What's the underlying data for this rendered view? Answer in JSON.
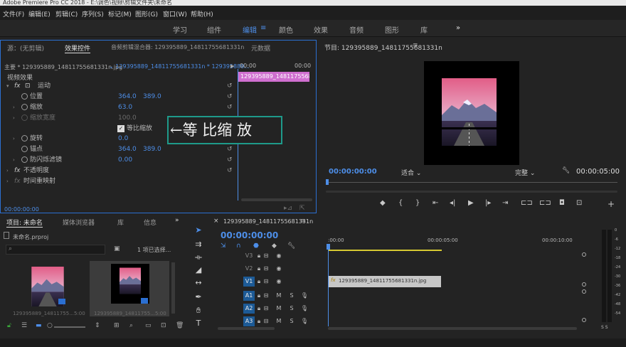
{
  "app": {
    "title": "Adobe Premiere Pro CC 2018 - E:\\调色\\视频\\剪辑文件夹\\未命名"
  },
  "menu": [
    "文件(F)",
    "编辑(E)",
    "剪辑(C)",
    "序列(S)",
    "标记(M)",
    "图形(G)",
    "窗口(W)",
    "帮助(H)"
  ],
  "workspaces": [
    "学习",
    "组件",
    "编辑",
    "颜色",
    "效果",
    "音频",
    "图形",
    "库"
  ],
  "workspace_active": "编辑",
  "workspace_more": "»",
  "effect_controls": {
    "tabs": [
      "源：(无剪辑)",
      "效果控件",
      "音频剪辑混合器: 129395889_14811755681331n",
      "元数据"
    ],
    "master_label": "主要 * 129395889_14811755681331n.jpg",
    "sequence_label": "129395889_14811755681331n * 129395889...",
    "time_start": "00:00",
    "time_end": "00:00",
    "clip_bar_label": "129395889_14811755681331n",
    "section_video": "视频效果",
    "motion": "运动",
    "params": [
      {
        "name": "位置",
        "v1": "364.0",
        "v2": "389.0"
      },
      {
        "name": "缩放",
        "v1": "63.0",
        "v2": ""
      },
      {
        "name": "缩放宽度",
        "v1": "100.0",
        "v2": ""
      },
      {
        "name": "旋转",
        "v1": "0.0",
        "v2": ""
      },
      {
        "name": "锚点",
        "v1": "364.0",
        "v2": "389.0"
      },
      {
        "name": "防闪烁滤镜",
        "v1": "0.00",
        "v2": ""
      }
    ],
    "uniform_scale": "等比缩放",
    "opacity": "不透明度",
    "time_remap": "时间重映射",
    "timecode": "00:00:00:00",
    "annotation": "←等 比缩 放"
  },
  "program": {
    "title": "节目: 129395889_14811755681331n",
    "timecode_left": "00:00:00:00",
    "fit": "适合",
    "quality": "完整",
    "timecode_right": "00:00:05:00"
  },
  "project": {
    "tabs": [
      "项目: 未命名",
      "媒体浏览器",
      "库",
      "信息"
    ],
    "file": "未命名.prproj",
    "selection": "1 项已选择...",
    "items": [
      {
        "name": "129395889_14811755...",
        "dur": "5:00"
      },
      {
        "name": "129395889_14811755...",
        "dur": "5:00"
      }
    ]
  },
  "timeline": {
    "title": "129395889_14811755681331n",
    "timecode": "00:00:00:00",
    "ruler": [
      ":00:00",
      "00:00:05:00",
      "00:00:10:00"
    ],
    "video_tracks": [
      "V3",
      "V2",
      "V1"
    ],
    "audio_tracks": [
      "A1",
      "A2",
      "A3"
    ],
    "clip": "129395889_14811755681331n.jpg",
    "m": "M",
    "s": "S"
  },
  "meter": {
    "labels": [
      "0",
      "-6",
      "-12",
      "-18",
      "-24",
      "-30",
      "-36",
      "-42",
      "-48",
      "-54"
    ],
    "s_labels": "S S"
  },
  "colors": {
    "accent": "#2b6fd1",
    "clip_pink": "#cf6fcf",
    "timecode": "#4d8ee8",
    "annotation": "#1e9a8a"
  }
}
